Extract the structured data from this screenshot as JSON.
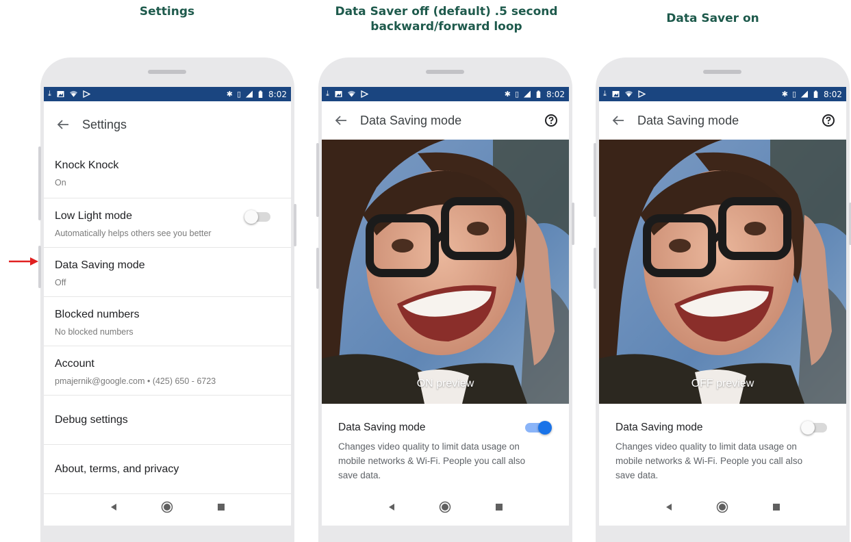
{
  "headings": {
    "left": "Settings",
    "middle": "Data Saver off (default) .5 second backward/forward loop",
    "right": "Data Saver on"
  },
  "status_bar": {
    "time": "8:02",
    "background": "#1a4580"
  },
  "settings_screen": {
    "title": "Settings",
    "items": [
      {
        "title": "Knock Knock",
        "subtitle": "On"
      },
      {
        "title": "Low Light mode",
        "subtitle": "Automatically helps others see you better",
        "toggle": "off"
      },
      {
        "title": "Data Saving mode",
        "subtitle": "Off"
      },
      {
        "title": "Blocked numbers",
        "subtitle": "No blocked numbers"
      },
      {
        "title": "Account",
        "subtitle": "pmajernik@google.com  •  (425) 650 - 6723"
      },
      {
        "title": "Debug settings"
      },
      {
        "title": "About, terms, and privacy"
      }
    ]
  },
  "data_saver_off_screen": {
    "title": "Data Saving mode",
    "preview_label": "ON preview",
    "setting_title": "Data Saving mode",
    "setting_description": "Changes video quality to limit data usage on mobile networks & Wi-Fi. People you call also save data.",
    "toggle": "on"
  },
  "data_saver_on_screen": {
    "title": "Data Saving mode",
    "preview_label": "OFF preview",
    "setting_title": "Data Saving mode",
    "setting_description": "Changes video quality to limit data usage on mobile networks & Wi-Fi. People you call also save data.",
    "toggle": "off"
  },
  "colors": {
    "heading": "#1e5a4c",
    "toggle_on": "#1a73e8",
    "arrow": "#e02020"
  }
}
